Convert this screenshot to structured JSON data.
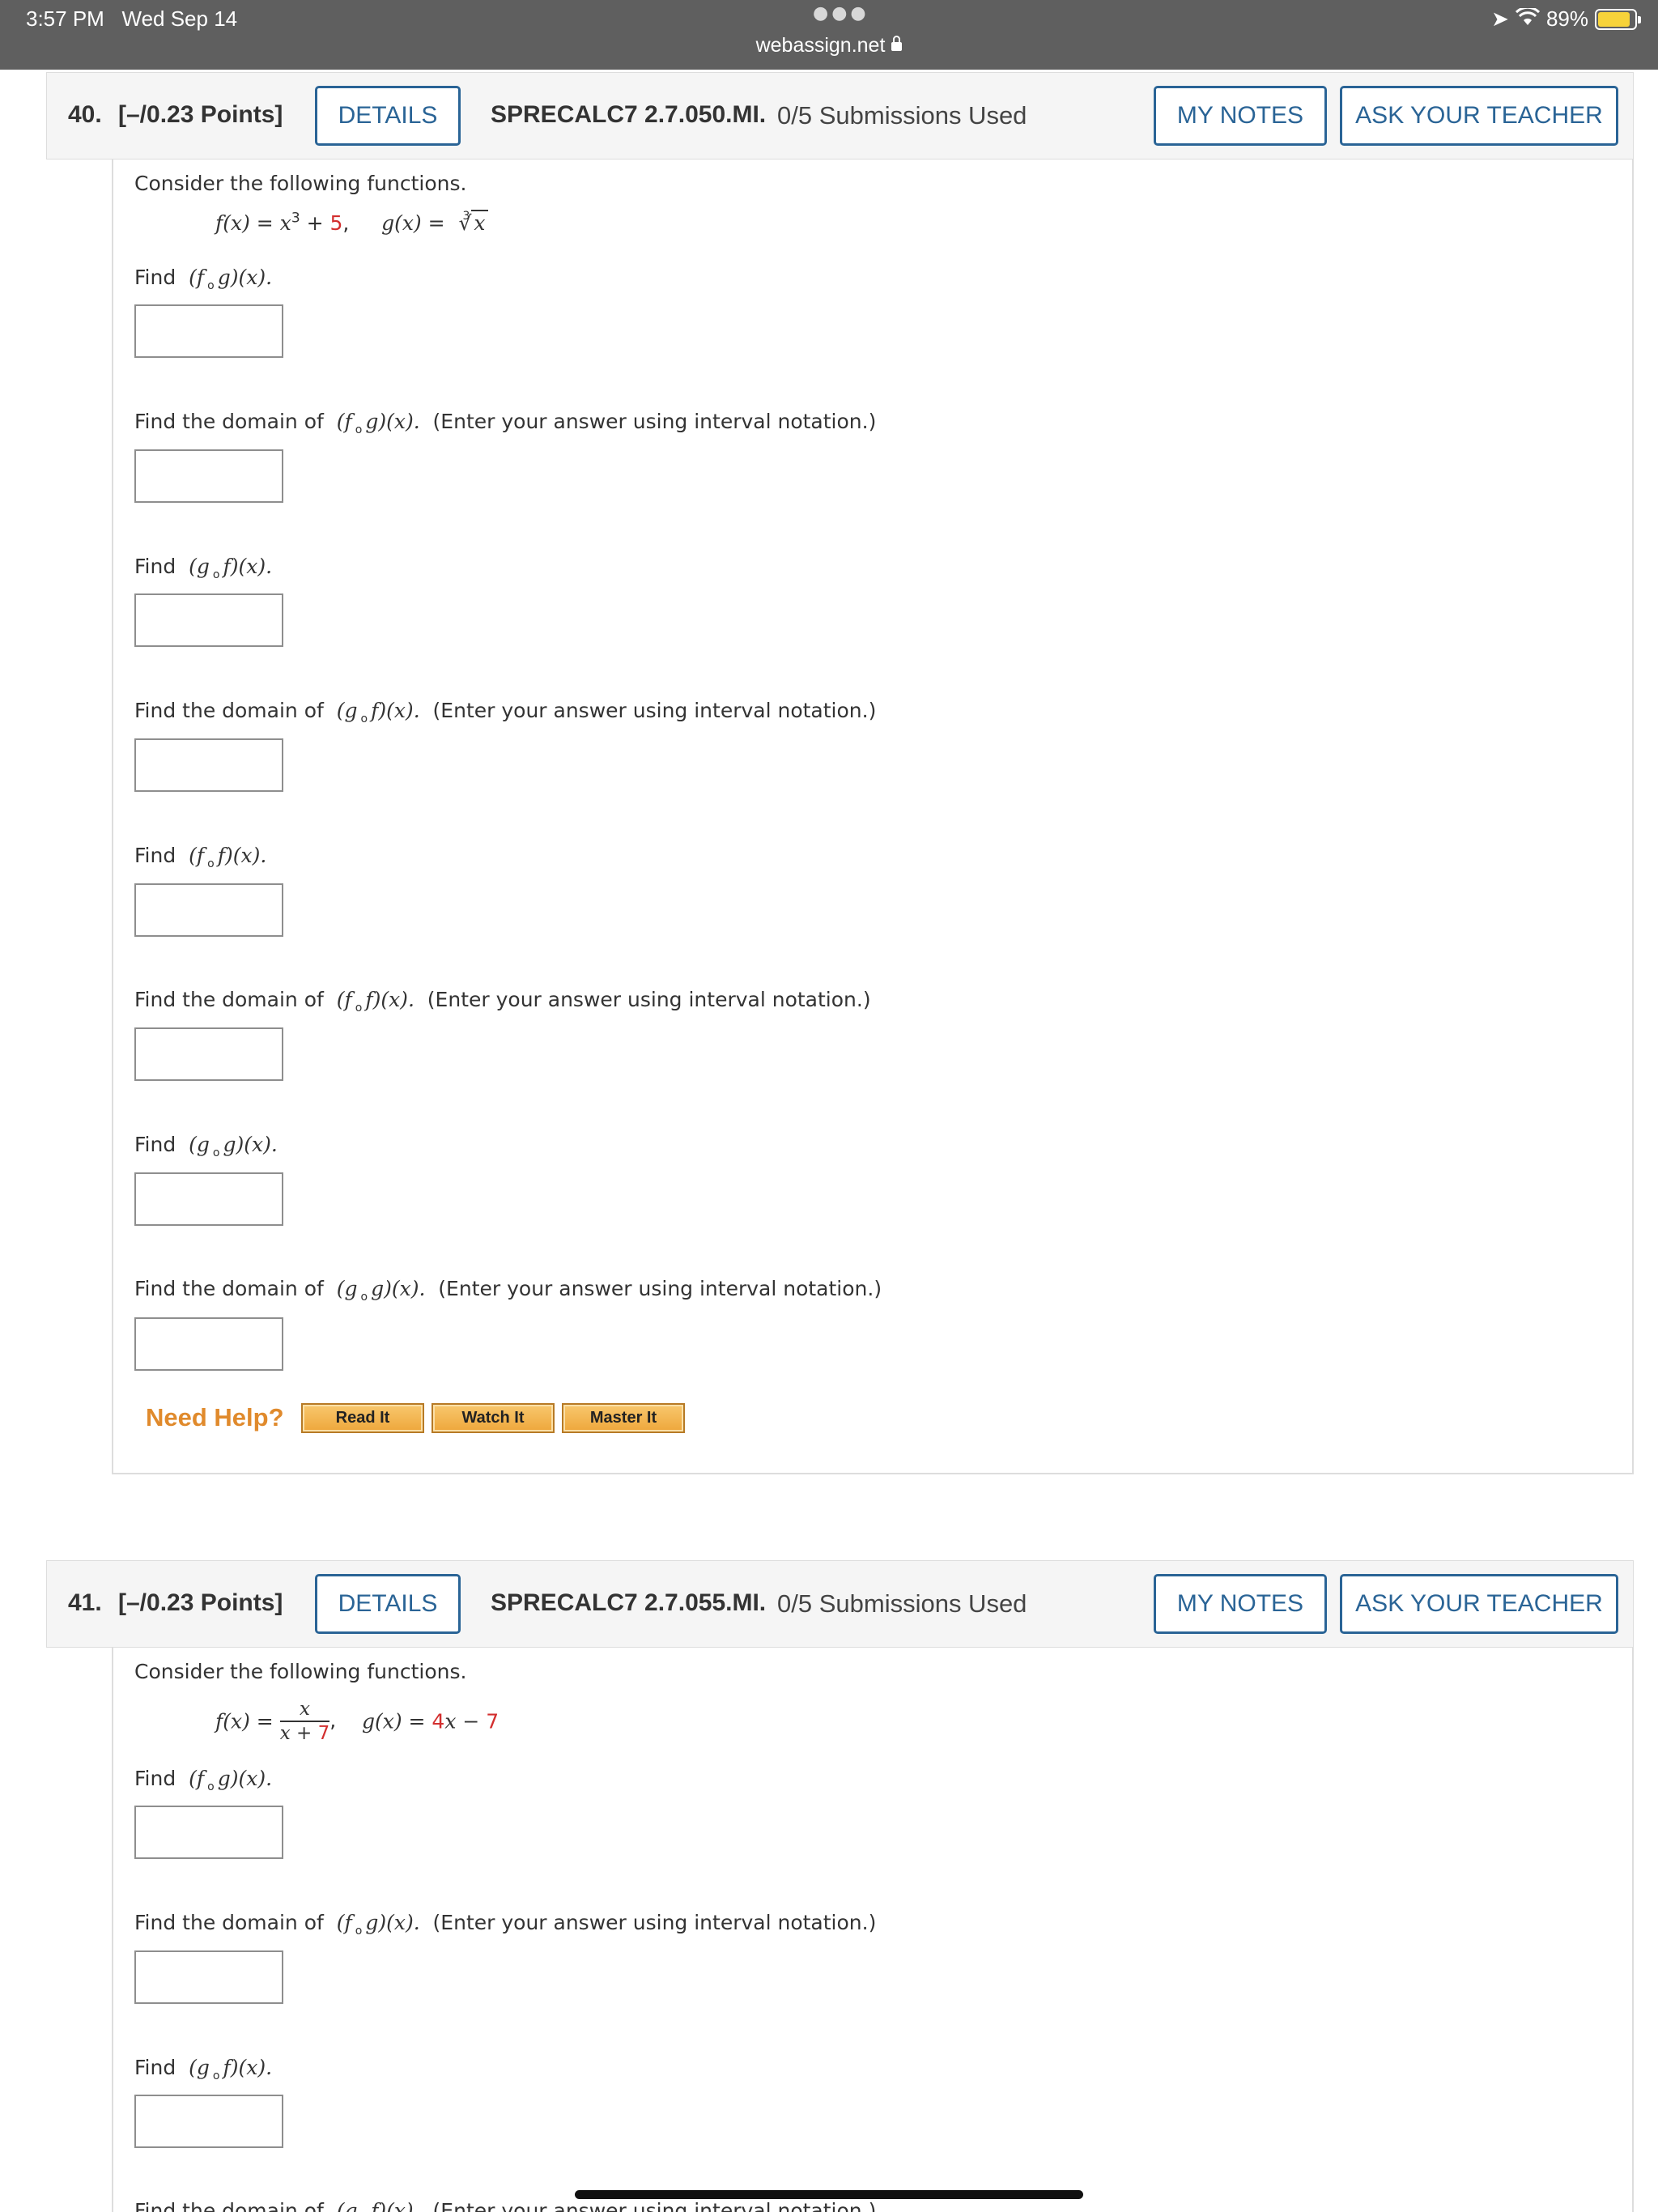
{
  "status_bar": {
    "time": "3:57 PM",
    "date": "Wed Sep 14",
    "url": "webassign.net",
    "battery": "89%"
  },
  "questions": [
    {
      "number": "40.",
      "points": "[–/0.23 Points]",
      "details_label": "DETAILS",
      "code": "SPRECALC7 2.7.050.MI.",
      "submissions": "0/5 Submissions Used",
      "notes_label": "MY NOTES",
      "ask_label": "ASK YOUR TEACHER",
      "intro": "Consider the following functions.",
      "f_prefix": "f(x) = x",
      "f_exp": "3",
      "f_plus": " + ",
      "f_const": "5",
      "g_prefix": "g(x) = ",
      "g_root_index": "3",
      "g_radicand": "x",
      "prompts": [
        {
          "find": "Find",
          "expr_a": "(f",
          "expr_b": "g)(x).",
          "note": ""
        },
        {
          "find": "Find the domain of",
          "expr_a": "(f",
          "expr_b": "g)(x).",
          "note": "(Enter your answer using interval notation.)"
        },
        {
          "find": "Find",
          "expr_a": "(g",
          "expr_b": "f)(x).",
          "note": ""
        },
        {
          "find": "Find the domain of",
          "expr_a": "(g",
          "expr_b": "f)(x).",
          "note": "(Enter your answer using interval notation.)"
        },
        {
          "find": "Find",
          "expr_a": "(f",
          "expr_b": "f)(x).",
          "note": ""
        },
        {
          "find": "Find the domain of",
          "expr_a": "(f",
          "expr_b": "f)(x).",
          "note": "(Enter your answer using interval notation.)"
        },
        {
          "find": "Find",
          "expr_a": "(g",
          "expr_b": "g)(x).",
          "note": ""
        },
        {
          "find": "Find the domain of",
          "expr_a": "(g",
          "expr_b": "g)(x).",
          "note": "(Enter your answer using interval notation.)"
        }
      ],
      "need_help": "Need Help?",
      "help_buttons": [
        "Read It",
        "Watch It",
        "Master It"
      ]
    },
    {
      "number": "41.",
      "points": "[–/0.23 Points]",
      "details_label": "DETAILS",
      "code": "SPRECALC7 2.7.055.MI.",
      "submissions": "0/5 Submissions Used",
      "notes_label": "MY NOTES",
      "ask_label": "ASK YOUR TEACHER",
      "intro": "Consider the following functions.",
      "f_prefix": "f(x) = ",
      "f_num": "x",
      "f_den_prefix": "x + ",
      "f_den_const": "7",
      "g_prefix": "g(x) = ",
      "g_coef": "4",
      "g_var": "x − ",
      "g_const": "7",
      "prompts": [
        {
          "find": "Find",
          "expr_a": "(f",
          "expr_b": "g)(x).",
          "note": ""
        },
        {
          "find": "Find the domain of",
          "expr_a": "(f",
          "expr_b": "g)(x).",
          "note": "(Enter your answer using interval notation.)"
        },
        {
          "find": "Find",
          "expr_a": "(g",
          "expr_b": "f)(x).",
          "note": ""
        },
        {
          "find": "Find the domain of",
          "expr_a": "(g",
          "expr_b": "f)(x).",
          "note": "(Enter your answer using interval notation.)"
        }
      ]
    }
  ]
}
